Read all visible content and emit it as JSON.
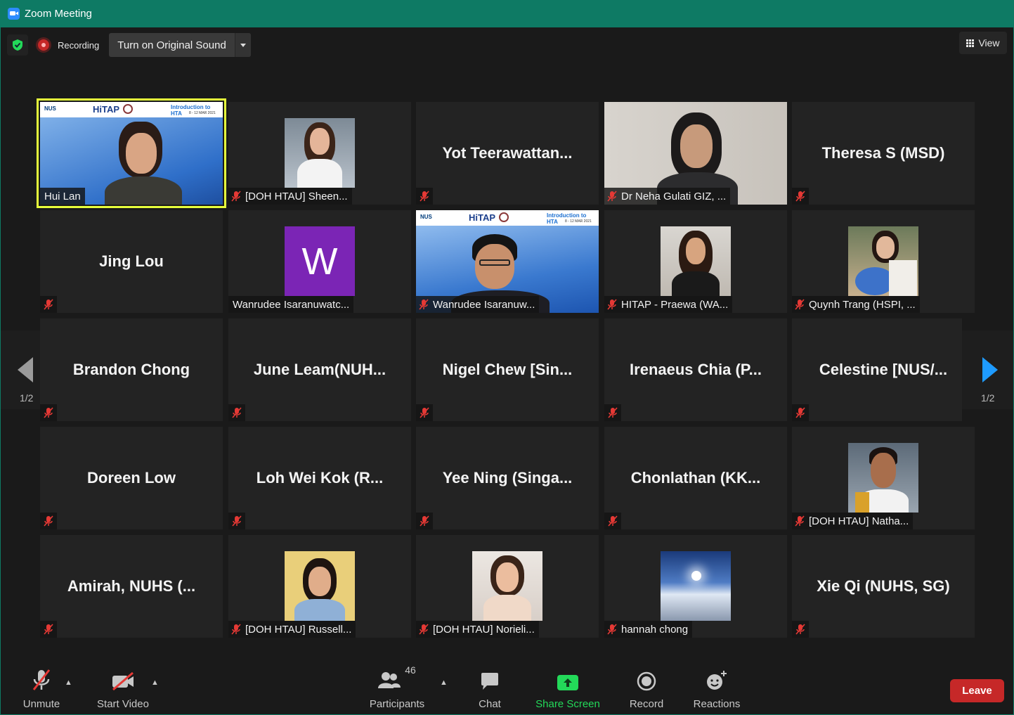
{
  "window": {
    "title": "Zoom Meeting"
  },
  "topbar": {
    "recording_label": "Recording",
    "original_sound_label": "Turn on Original Sound",
    "view_label": "View"
  },
  "pager": {
    "left": "1/2",
    "right": "1/2"
  },
  "banner": {
    "hitap": "HiTAP",
    "intro": "Introduction to HTA",
    "date": "8 - 12 MAR 2021",
    "nus": "NUS"
  },
  "tiles": [
    {
      "name": "Hui Lan",
      "active": true
    },
    {
      "name": "[DOH HTAU] Sheen..."
    },
    {
      "name": "Yot  Teerawattan..."
    },
    {
      "name": "Dr Neha Gulati GIZ, ..."
    },
    {
      "name": "Theresa S (MSD)"
    },
    {
      "name": "Jing Lou"
    },
    {
      "name": "Wanrudee Isaranuwatc...",
      "avatar_letter": "W"
    },
    {
      "name": "Wanrudee Isaranuw..."
    },
    {
      "name": "HITAP - Praewa (WA..."
    },
    {
      "name": "Quynh Trang (HSPI, ..."
    },
    {
      "name": "Brandon Chong"
    },
    {
      "name": "June  Leam(NUH..."
    },
    {
      "name": "Nigel Chew [Sin..."
    },
    {
      "name": "Irenaeus Chia (P..."
    },
    {
      "name": "Celestine  [NUS/..."
    },
    {
      "name": "Doreen Low"
    },
    {
      "name": "Loh Wei Kok (R..."
    },
    {
      "name": "Yee Ning (Singa..."
    },
    {
      "name": "Chonlathan  (KK..."
    },
    {
      "name": "[DOH HTAU] Natha..."
    },
    {
      "name": "Amirah, NUHS (..."
    },
    {
      "name": "[DOH HTAU] Russell..."
    },
    {
      "name": "[DOH HTAU] Norieli..."
    },
    {
      "name": "hannah chong"
    },
    {
      "name": "Xie Qi (NUHS, SG)"
    }
  ],
  "toolbar": {
    "unmute": "Unmute",
    "start_video": "Start Video",
    "participants": "Participants",
    "participants_count": "46",
    "chat": "Chat",
    "share_screen": "Share Screen",
    "record": "Record",
    "reactions": "Reactions",
    "leave": "Leave"
  },
  "colors": {
    "titlebar": "#0e7a64",
    "active_speaker": "#e6ff3b",
    "leave": "#c62828",
    "share": "#23d959",
    "mute_red": "#e53935"
  }
}
